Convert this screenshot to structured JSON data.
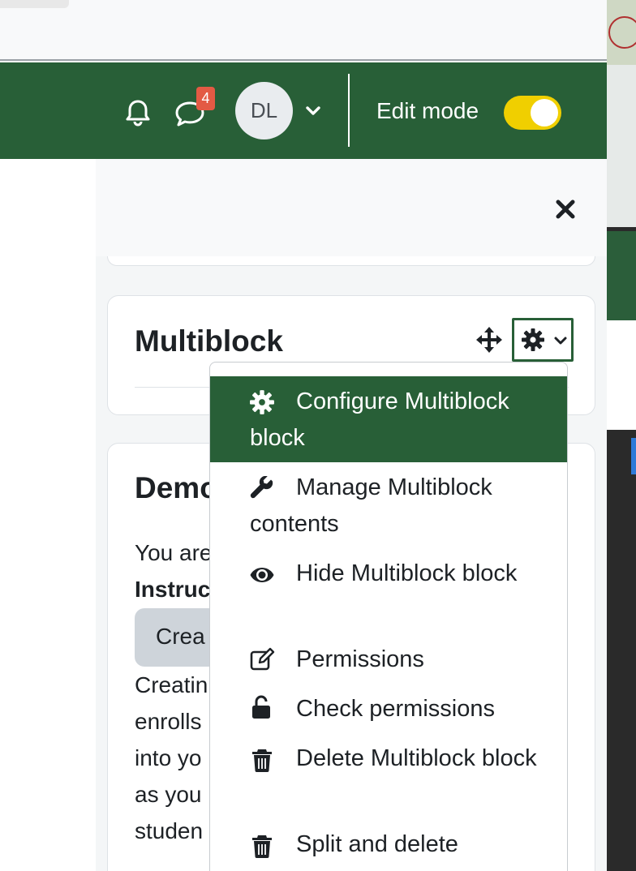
{
  "navbar": {
    "notification_count": "4",
    "avatar_initials": "DL",
    "edit_mode_label": "Edit mode",
    "edit_mode_on": true,
    "colors": {
      "navbar_bg": "#285f37",
      "toggle_on": "#f0cf00",
      "badge": "#e35a44"
    }
  },
  "drawer": {
    "multiblock_title": "Multiblock",
    "demo": {
      "title": "Demo",
      "lines": [
        "You are",
        "Instruc",
        "Creatin",
        "enrolls",
        "into yo",
        "as you",
        "studen"
      ],
      "create_button": "Crea"
    }
  },
  "menu": {
    "items": [
      {
        "label": "Configure Multiblock block",
        "icon": "gear-icon"
      },
      {
        "label": "Manage Multiblock contents",
        "icon": "wrench-icon"
      },
      {
        "label": "Hide Multiblock block",
        "icon": "eye-icon"
      },
      {
        "label": "Permissions",
        "icon": "edit-icon"
      },
      {
        "label": "Check permissions",
        "icon": "unlock-icon"
      },
      {
        "label": "Delete Multiblock block",
        "icon": "trash-icon"
      },
      {
        "label": "Split and delete",
        "icon": "trash-icon"
      }
    ]
  }
}
